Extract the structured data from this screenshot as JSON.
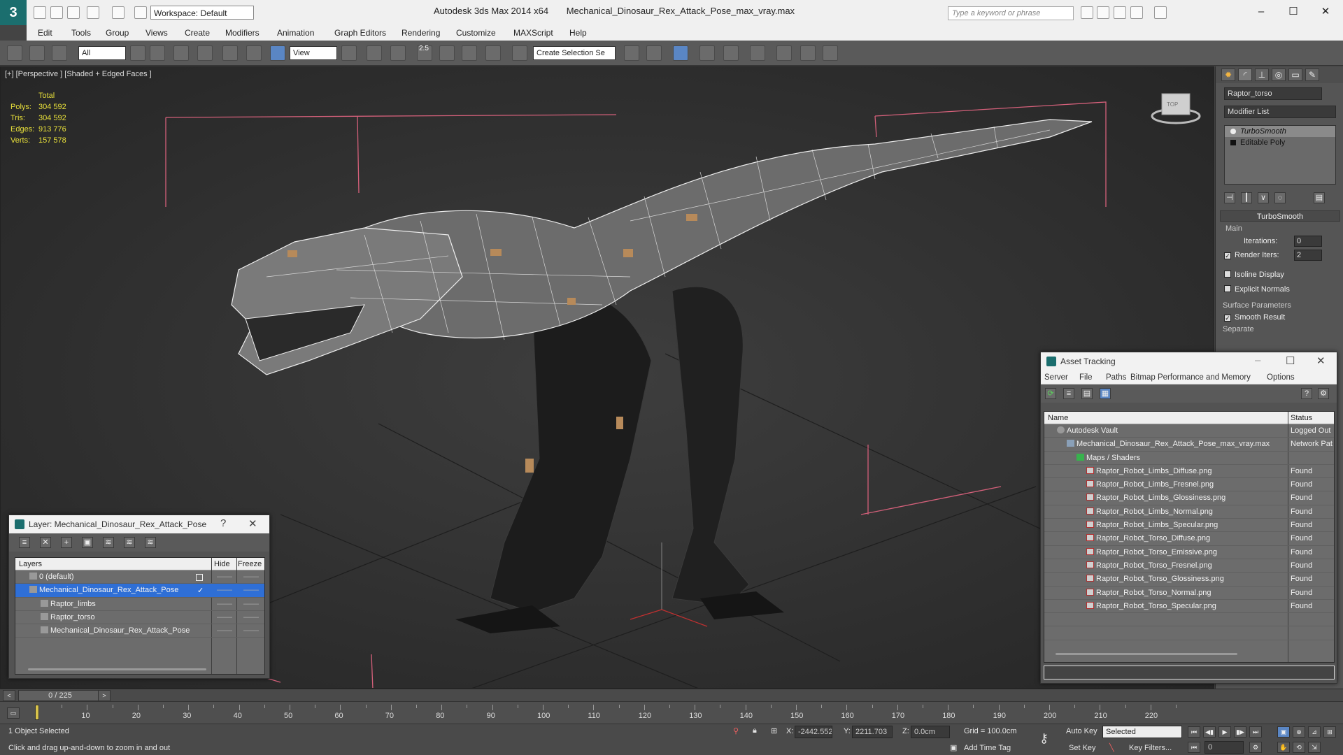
{
  "app": {
    "logo": "3",
    "workspace": "Workspace: Default",
    "product": "Autodesk 3ds Max  2014 x64",
    "file": "Mechanical_Dinosaur_Rex_Attack_Pose_max_vray.max",
    "search_placeholder": "Type a keyword or phrase"
  },
  "menu": [
    "Edit",
    "Tools",
    "Group",
    "Views",
    "Create",
    "Modifiers",
    "Animation",
    "Graph Editors",
    "Rendering",
    "Customize",
    "MAXScript",
    "Help"
  ],
  "toolbar": {
    "filter": "All",
    "ref_coord": "View",
    "selection_set": "Create Selection Se",
    "snap_angle": "2.5"
  },
  "viewport": {
    "label": "[+] [Perspective ] [Shaded + Edged Faces ]",
    "stats_header": "Total",
    "stats": [
      {
        "k": "Polys:",
        "v": "304 592"
      },
      {
        "k": "Tris:",
        "v": "304 592"
      },
      {
        "k": "Edges:",
        "v": "913 776"
      },
      {
        "k": "Verts:",
        "v": "157 578"
      }
    ]
  },
  "command_panel": {
    "object_name": "Raptor_torso",
    "modifier_list": "Modifier List",
    "stack": [
      "TurboSmooth",
      "Editable Poly"
    ],
    "rollout": "TurboSmooth",
    "group_main": "Main",
    "iterations_label": "Iterations:",
    "iterations_value": "0",
    "render_iters_label": "Render Iters:",
    "render_iters_value": "2",
    "isoline": "Isoline Display",
    "explicit_normals": "Explicit Normals",
    "surface_params": "Surface Parameters",
    "smooth_result": "Smooth Result",
    "separate": "Separate"
  },
  "layer_panel": {
    "title": "Layer: Mechanical_Dinosaur_Rex_Attack_Pose",
    "help": "?",
    "close": "✕",
    "col_layers": "Layers",
    "col_hide": "Hide",
    "col_freeze": "Freeze",
    "rows": [
      {
        "name": "0 (default)",
        "indent": 0,
        "selected": false
      },
      {
        "name": "Mechanical_Dinosaur_Rex_Attack_Pose",
        "indent": 0,
        "selected": true
      },
      {
        "name": "Raptor_limbs",
        "indent": 1,
        "selected": false
      },
      {
        "name": "Raptor_torso",
        "indent": 1,
        "selected": false
      },
      {
        "name": "Mechanical_Dinosaur_Rex_Attack_Pose",
        "indent": 1,
        "selected": false
      }
    ],
    "dash": "——"
  },
  "asset_panel": {
    "title": "Asset Tracking",
    "menu": [
      "Server",
      "File",
      "Paths",
      "Bitmap Performance and Memory",
      "Options"
    ],
    "col_name": "Name",
    "col_status": "Status",
    "rows": [
      {
        "name": "Autodesk Vault",
        "status": "Logged Out",
        "indent": 1,
        "icon": "vault"
      },
      {
        "name": "Mechanical_Dinosaur_Rex_Attack_Pose_max_vray.max",
        "status": "Network Pat",
        "indent": 2,
        "icon": "file"
      },
      {
        "name": "Maps / Shaders",
        "status": "",
        "indent": 3,
        "icon": "folder"
      },
      {
        "name": "Raptor_Robot_Limbs_Diffuse.png",
        "status": "Found",
        "indent": 4,
        "icon": "png"
      },
      {
        "name": "Raptor_Robot_Limbs_Fresnel.png",
        "status": "Found",
        "indent": 4,
        "icon": "png"
      },
      {
        "name": "Raptor_Robot_Limbs_Glossiness.png",
        "status": "Found",
        "indent": 4,
        "icon": "png"
      },
      {
        "name": "Raptor_Robot_Limbs_Normal.png",
        "status": "Found",
        "indent": 4,
        "icon": "png"
      },
      {
        "name": "Raptor_Robot_Limbs_Specular.png",
        "status": "Found",
        "indent": 4,
        "icon": "png"
      },
      {
        "name": "Raptor_Robot_Torso_Diffuse.png",
        "status": "Found",
        "indent": 4,
        "icon": "png"
      },
      {
        "name": "Raptor_Robot_Torso_Emissive.png",
        "status": "Found",
        "indent": 4,
        "icon": "png"
      },
      {
        "name": "Raptor_Robot_Torso_Fresnel.png",
        "status": "Found",
        "indent": 4,
        "icon": "png"
      },
      {
        "name": "Raptor_Robot_Torso_Glossiness.png",
        "status": "Found",
        "indent": 4,
        "icon": "png"
      },
      {
        "name": "Raptor_Robot_Torso_Normal.png",
        "status": "Found",
        "indent": 4,
        "icon": "png"
      },
      {
        "name": "Raptor_Robot_Torso_Specular.png",
        "status": "Found",
        "indent": 4,
        "icon": "png"
      }
    ]
  },
  "timeline": {
    "frame": "0 / 225",
    "ticks": [
      "10",
      "20",
      "30",
      "40",
      "50",
      "60",
      "70",
      "80",
      "90",
      "100",
      "110",
      "120",
      "130",
      "140",
      "150",
      "160",
      "170",
      "180",
      "190",
      "200",
      "210",
      "220"
    ]
  },
  "status": {
    "selection": "1 Object Selected",
    "prompt": "Click and drag up-and-down to zoom in and out",
    "x_label": "X:",
    "x_value": "-2442.552",
    "y_label": "Y:",
    "y_value": "2211.703",
    "z_label": "Z:",
    "z_value": "0.0cm",
    "grid": "Grid = 100.0cm",
    "auto_key": "Auto Key",
    "set_key": "Set Key",
    "selected": "Selected",
    "key_filters": "Key Filters...",
    "add_time_tag": "Add Time Tag",
    "frame_field": "0"
  },
  "colors": {
    "accent": "#2f6fd6",
    "stats": "#e8e03a",
    "bbox": "#d4607a"
  }
}
